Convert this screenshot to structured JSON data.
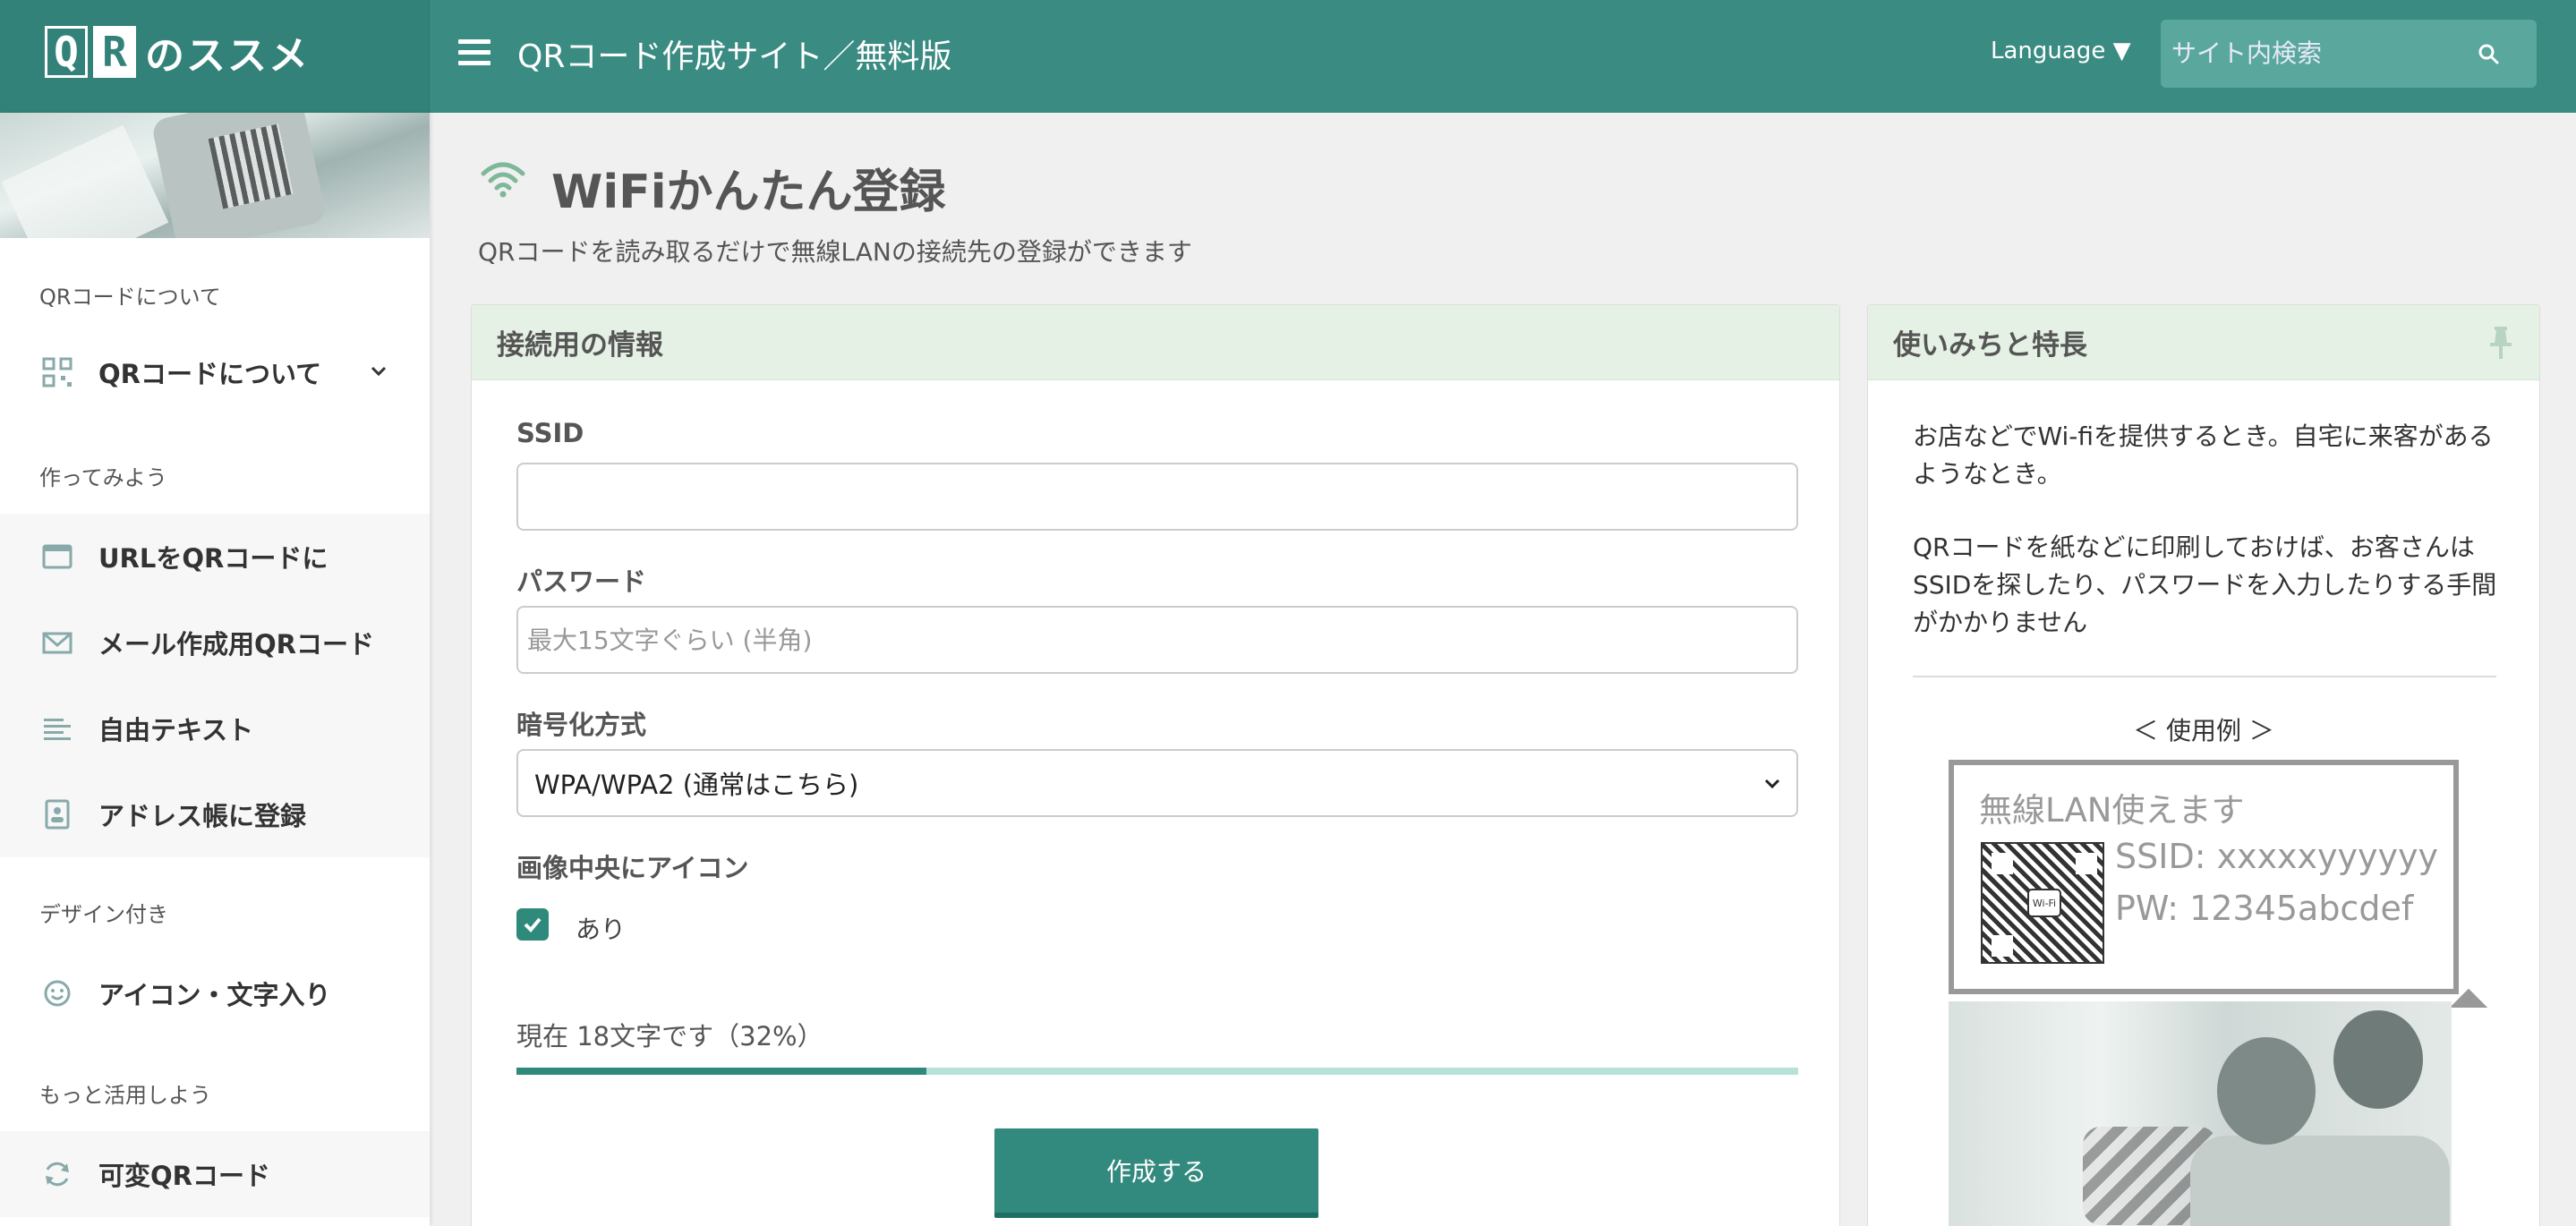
{
  "header": {
    "logo_text": "のススメ",
    "logo_q": "Q",
    "logo_r": "R",
    "site_title": "QRコード作成サイト／無料版",
    "language_label": "Language ▼",
    "search_placeholder": "サイト内検索"
  },
  "sidebar": {
    "sections": [
      {
        "title": "QRコードについて",
        "items": [
          {
            "label": "QRコードについて",
            "icon": "qr-icon",
            "expandable": true
          }
        ]
      },
      {
        "title": "作ってみよう",
        "items": [
          {
            "label": "URLをQRコードに",
            "icon": "browser-window-icon"
          },
          {
            "label": "メール作成用QRコード",
            "icon": "envelope-icon"
          },
          {
            "label": "自由テキスト",
            "icon": "text-lines-icon"
          },
          {
            "label": "アドレス帳に登録",
            "icon": "contact-card-icon"
          }
        ]
      },
      {
        "title": "デザイン付き",
        "items": [
          {
            "label": "アイコン・文字入り",
            "icon": "smiley-icon"
          }
        ]
      },
      {
        "title": "もっと活用しよう",
        "items": [
          {
            "label": "可変QRコード",
            "icon": "refresh-icon"
          }
        ]
      }
    ]
  },
  "main": {
    "title": "WiFiかんたん登録",
    "subtitle": "QRコードを読み取るだけで無線LANの接続先の登録ができます",
    "form_card": {
      "header": "接続用の情報",
      "ssid_label": "SSID",
      "ssid_value": "",
      "password_label": "パスワード",
      "password_placeholder": "最大15文字ぐらい (半角)",
      "encryption_label": "暗号化方式",
      "encryption_selected": "WPA/WPA2 (通常はこちら)",
      "icon_label": "画像中央にアイコン",
      "icon_checkbox_label": "あり",
      "icon_checked": true,
      "status_text": "現在 18文字です（32%）",
      "progress_percent": 32,
      "submit_label": "作成する"
    },
    "info_card": {
      "header": "使いみちと特長",
      "paragraph1": "お店などでWi-fiを提供するとき。自宅に来客があるようなとき。",
      "paragraph2": "QRコードを紙などに印刷しておけば、お客さんはSSIDを探したり、パスワードを入力したりする手間がかかりません",
      "example_title": "＜ 使用例 ＞",
      "sample": {
        "heading": "無線LAN使えます",
        "ssid": "SSID: xxxxxyyyyyy",
        "pw": "PW: 12345abcdef",
        "badge": "Wi-Fi"
      }
    }
  },
  "colors": {
    "brand": "#3a8b82",
    "accent": "#2f8a7c",
    "card_header": "#e6f1e6"
  }
}
